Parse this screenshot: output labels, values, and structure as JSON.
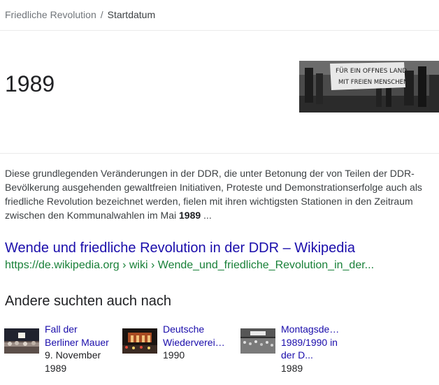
{
  "breadcrumb": {
    "parent": "Friedliche Revolution",
    "separator": "/",
    "current": "Startdatum"
  },
  "answer": {
    "value": "1989",
    "image_icon": "protest-photo-icon",
    "banner_line1": "FÜR EIN OFFNES LAND",
    "banner_line2": "MIT FREIEN MENSCHEN"
  },
  "snippet": {
    "text_before": "Diese grundlegenden Veränderungen in der DDR, die unter Betonung der von Teilen der DDR-Bevölkerung ausgehenden gewaltfreien Initiativen, Proteste und Demonstrationserfolge auch als friedliche Revolution bezeichnet werden, fielen mit ihren wichtigsten Stationen in den Zeitraum zwischen den Kommunalwahlen im Mai ",
    "highlight": "1989",
    "text_after": " ..."
  },
  "result": {
    "title": "Wende und friedliche Revolution in der DDR – Wikipedia",
    "url": "https://de.wikipedia.org › wiki › Wende_und_friedliche_Revolution_in_der..."
  },
  "related": {
    "heading": "Andere suchten auch nach",
    "items": [
      {
        "line1": "Fall der",
        "line2": "Berliner Mauer",
        "sub1": "9. November",
        "sub2": "1989",
        "icon": "berlin-wall-photo-icon"
      },
      {
        "line1": "Deutsche",
        "line2": "Wiederverei…",
        "sub1": "1990",
        "icon": "reunification-photo-icon"
      },
      {
        "line1": "Montagsde…",
        "line2": "1989/1990 in",
        "line3": "der D...",
        "sub1": "1989",
        "icon": "monday-demonstration-photo-icon"
      }
    ]
  },
  "colors": {
    "link": "#1a0dab",
    "url_green": "#188038",
    "text": "#202124",
    "muted": "#70757a"
  }
}
